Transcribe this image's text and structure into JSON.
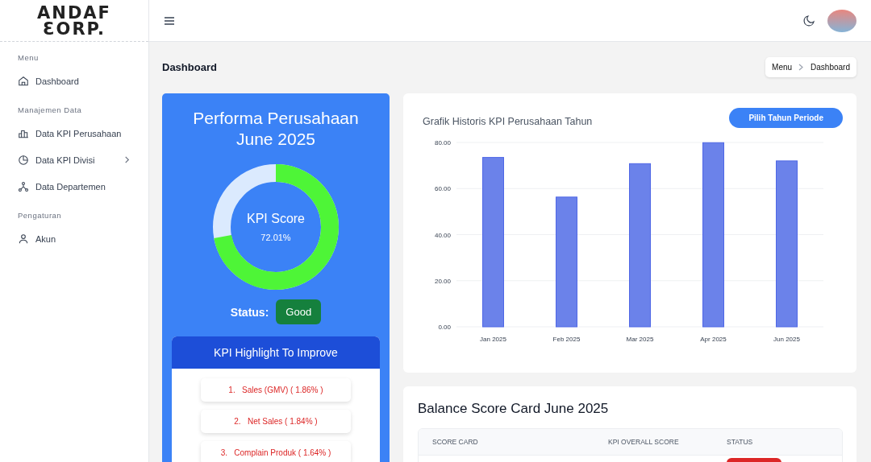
{
  "sidebar": {
    "logo": [
      "ANDAF",
      "ƐORP."
    ],
    "sections": [
      {
        "heading": "Menu",
        "items": [
          {
            "label": "Dashboard",
            "expandable": false
          }
        ]
      },
      {
        "heading": "Manajemen Data",
        "items": [
          {
            "label": "Data KPI Perusahaan",
            "expandable": false
          },
          {
            "label": "Data KPI Divisi",
            "expandable": true
          },
          {
            "label": "Data Departemen",
            "expandable": false
          }
        ]
      },
      {
        "heading": "Pengaturan",
        "items": [
          {
            "label": "Akun",
            "expandable": false
          }
        ]
      }
    ]
  },
  "page": {
    "title": "Dashboard",
    "breadcrumb": [
      "Menu",
      "Dashboard"
    ]
  },
  "performance": {
    "title": "Performa Perusahaan June 2025",
    "score_label": "KPI Score",
    "score": "72.01%",
    "level": 0.7201,
    "status_label": "Status:",
    "status": "Good",
    "highlight_title": "KPI Highlight To Improve",
    "highlights": [
      {
        "number": "1.",
        "text": "Sales (GMV) ( 1.86% )"
      },
      {
        "number": "2.",
        "text": "Net Sales ( 1.84% )"
      },
      {
        "number": "3.",
        "text": "Complain Produk ( 1.64% )"
      }
    ]
  },
  "history": {
    "title": "Grafik Historis KPI Perusahaan Tahun",
    "button": "Pilih Tahun Periode",
    "chart_data": {
      "type": "bar",
      "categories": [
        "Jan 2025",
        "Feb 2025",
        "Mar 2025",
        "Apr 2025",
        "Jun 2025"
      ],
      "grid": true,
      "series": [
        {
          "color": "#6b82ea",
          "values": [
            73.5,
            56.3,
            70.8,
            79.9,
            72.0
          ]
        }
      ],
      "ylim": [
        0,
        80
      ],
      "yticks": [
        {
          "value": 0,
          "label": "0.00"
        },
        {
          "value": 20,
          "label": "20.00"
        },
        {
          "value": 40,
          "label": "40.00"
        },
        {
          "value": 60,
          "label": "60.00"
        },
        {
          "value": 80,
          "label": "80.00"
        }
      ]
    }
  },
  "balance": {
    "title": "Balance Score Card June 2025",
    "columns": [
      "SCORE CARD",
      "KPI OVERALL SCORE",
      "STATUS"
    ]
  }
}
